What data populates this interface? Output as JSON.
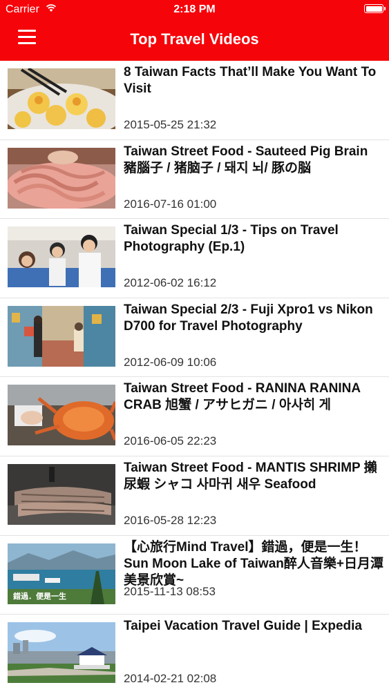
{
  "status_bar": {
    "carrier": "Carrier",
    "time": "2:18 PM"
  },
  "nav": {
    "title": "Top Travel Videos",
    "menu_icon": "hamburger-menu-icon"
  },
  "colors": {
    "accent": "#f5040a",
    "text": "#111111",
    "separator": "#e2e2e2"
  },
  "videos": [
    {
      "title": "8 Taiwan Facts That’ll Make You Want To Visit",
      "date": "2015-05-25 21:32"
    },
    {
      "title": "Taiwan Street Food - Sauteed Pig Brain  豬腦子 / 猪脑子 / 돼지 뇌/ 豚の脳",
      "date": "2016-07-16 01:00"
    },
    {
      "title": "Taiwan Special 1/3 - Tips on Travel Photography (Ep.1)",
      "date": "2012-06-02 16:12"
    },
    {
      "title": "Taiwan Special 2/3 - Fuji Xpro1 vs Nikon D700 for Travel Photography",
      "date": "2012-06-09 10:06"
    },
    {
      "title": "Taiwan Street Food - RANINA RANINA CRAB 旭蟹 / アサヒガニ / 아사히 게",
      "date": "2016-06-05 22:23"
    },
    {
      "title": "Taiwan Street Food - MANTIS SHRIMP 攋尿蝦 シャコ 사마귀 새우 Seafood",
      "date": "2016-05-28 12:23"
    },
    {
      "title": "【心旅行Mind Travel】錯過，便是一生！ Sun Moon Lake of Taiwan醉人音樂+日月潭美景欣賞~",
      "date": "2015-11-13 08:53",
      "thumb_caption": "錯過．便是一生"
    },
    {
      "title": "Taipei Vacation Travel Guide | Expedia",
      "date": "2014-02-21 02:08"
    }
  ]
}
